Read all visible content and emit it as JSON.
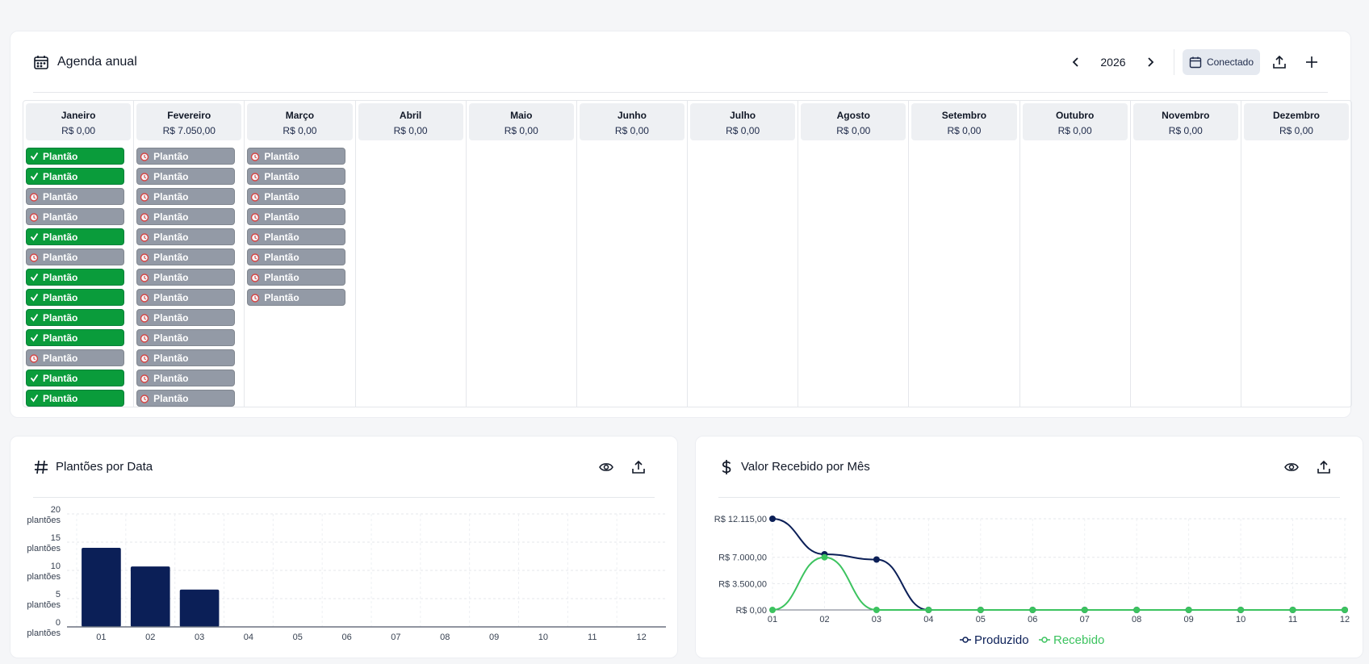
{
  "agenda": {
    "title": "Agenda anual",
    "year": "2026",
    "connect_label": "Conectado",
    "months": [
      {
        "name": "Janeiro",
        "value": "R$ 0,00",
        "shifts": [
          "done",
          "done",
          "pend",
          "pend",
          "done",
          "pend",
          "done",
          "done",
          "done",
          "done",
          "pend",
          "done",
          "done"
        ]
      },
      {
        "name": "Fevereiro",
        "value": "R$ 7.050,00",
        "shifts": [
          "pend",
          "pend",
          "pend",
          "pend",
          "pend",
          "pend",
          "pend",
          "pend",
          "pend",
          "pend",
          "pend",
          "pend",
          "pend"
        ]
      },
      {
        "name": "Março",
        "value": "R$ 0,00",
        "shifts": [
          "pend",
          "pend",
          "pend",
          "pend",
          "pend",
          "pend",
          "pend",
          "pend"
        ]
      },
      {
        "name": "Abril",
        "value": "R$ 0,00",
        "shifts": []
      },
      {
        "name": "Maio",
        "value": "R$ 0,00",
        "shifts": []
      },
      {
        "name": "Junho",
        "value": "R$ 0,00",
        "shifts": []
      },
      {
        "name": "Julho",
        "value": "R$ 0,00",
        "shifts": []
      },
      {
        "name": "Agosto",
        "value": "R$ 0,00",
        "shifts": []
      },
      {
        "name": "Setembro",
        "value": "R$ 0,00",
        "shifts": []
      },
      {
        "name": "Outubro",
        "value": "R$ 0,00",
        "shifts": []
      },
      {
        "name": "Novembro",
        "value": "R$ 0,00",
        "shifts": []
      },
      {
        "name": "Dezembro",
        "value": "R$ 0,00",
        "shifts": []
      }
    ],
    "shift_label": "Plantão"
  },
  "chart1": {
    "title": "Plantões por Data"
  },
  "chart2": {
    "title": "Valor Recebido por Mês"
  },
  "chart_data": [
    {
      "type": "bar",
      "title": "Plantões por Data",
      "categories": [
        "01",
        "02",
        "03",
        "04",
        "05",
        "06",
        "07",
        "08",
        "09",
        "10",
        "11",
        "12"
      ],
      "values": [
        14,
        10.7,
        6.6,
        0,
        0,
        0,
        0,
        0,
        0,
        0,
        0,
        0
      ],
      "ylim": [
        0,
        20
      ],
      "yticks": [
        {
          "v": 0,
          "l1": "0",
          "l2": "plantões"
        },
        {
          "v": 5,
          "l1": "5",
          "l2": "plantões"
        },
        {
          "v": 10,
          "l1": "10",
          "l2": "plantões"
        },
        {
          "v": 15,
          "l1": "15",
          "l2": "plantões"
        },
        {
          "v": 20,
          "l1": "20",
          "l2": "plantões"
        }
      ],
      "grid": true,
      "colors": {
        "bar": "#0b1f57"
      }
    },
    {
      "type": "line",
      "title": "Valor Recebido por Mês",
      "x": [
        "01",
        "02",
        "03",
        "04",
        "05",
        "06",
        "07",
        "08",
        "09",
        "10",
        "11",
        "12"
      ],
      "series": [
        {
          "name": "Produzido",
          "values": [
            12115,
            7400,
            6700,
            0,
            0,
            0,
            0,
            0,
            0,
            0,
            0,
            0
          ],
          "color": "#0b1f57"
        },
        {
          "name": "Recebido",
          "values": [
            0,
            7000,
            0,
            0,
            0,
            0,
            0,
            0,
            0,
            0,
            0,
            0
          ],
          "color": "#3cc35f"
        }
      ],
      "ylim": [
        0,
        12115
      ],
      "yticks": [
        {
          "v": 0,
          "label": "R$ 0,00"
        },
        {
          "v": 3500,
          "label": "R$ 3.500,00"
        },
        {
          "v": 7000,
          "label": "R$ 7.000,00"
        },
        {
          "v": 12115,
          "label": "R$ 12.115,00"
        }
      ],
      "grid": true,
      "legend": "bottom-center"
    }
  ]
}
